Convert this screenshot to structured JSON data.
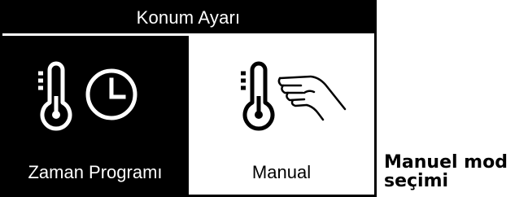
{
  "screen": {
    "title": "Konum Ayarı",
    "options": [
      {
        "label": "Zaman Programı",
        "icons": [
          "thermometer-icon",
          "clock-icon"
        ],
        "selected": false
      },
      {
        "label": "Manual",
        "icons": [
          "thermometer-icon",
          "hand-icon"
        ],
        "selected": true
      }
    ]
  },
  "caption": {
    "line1": "Manuel mod",
    "line2": "seçimi"
  },
  "colors": {
    "background": "#000000",
    "foreground": "#ffffff",
    "selected_background": "#ffffff",
    "selected_foreground": "#000000"
  }
}
